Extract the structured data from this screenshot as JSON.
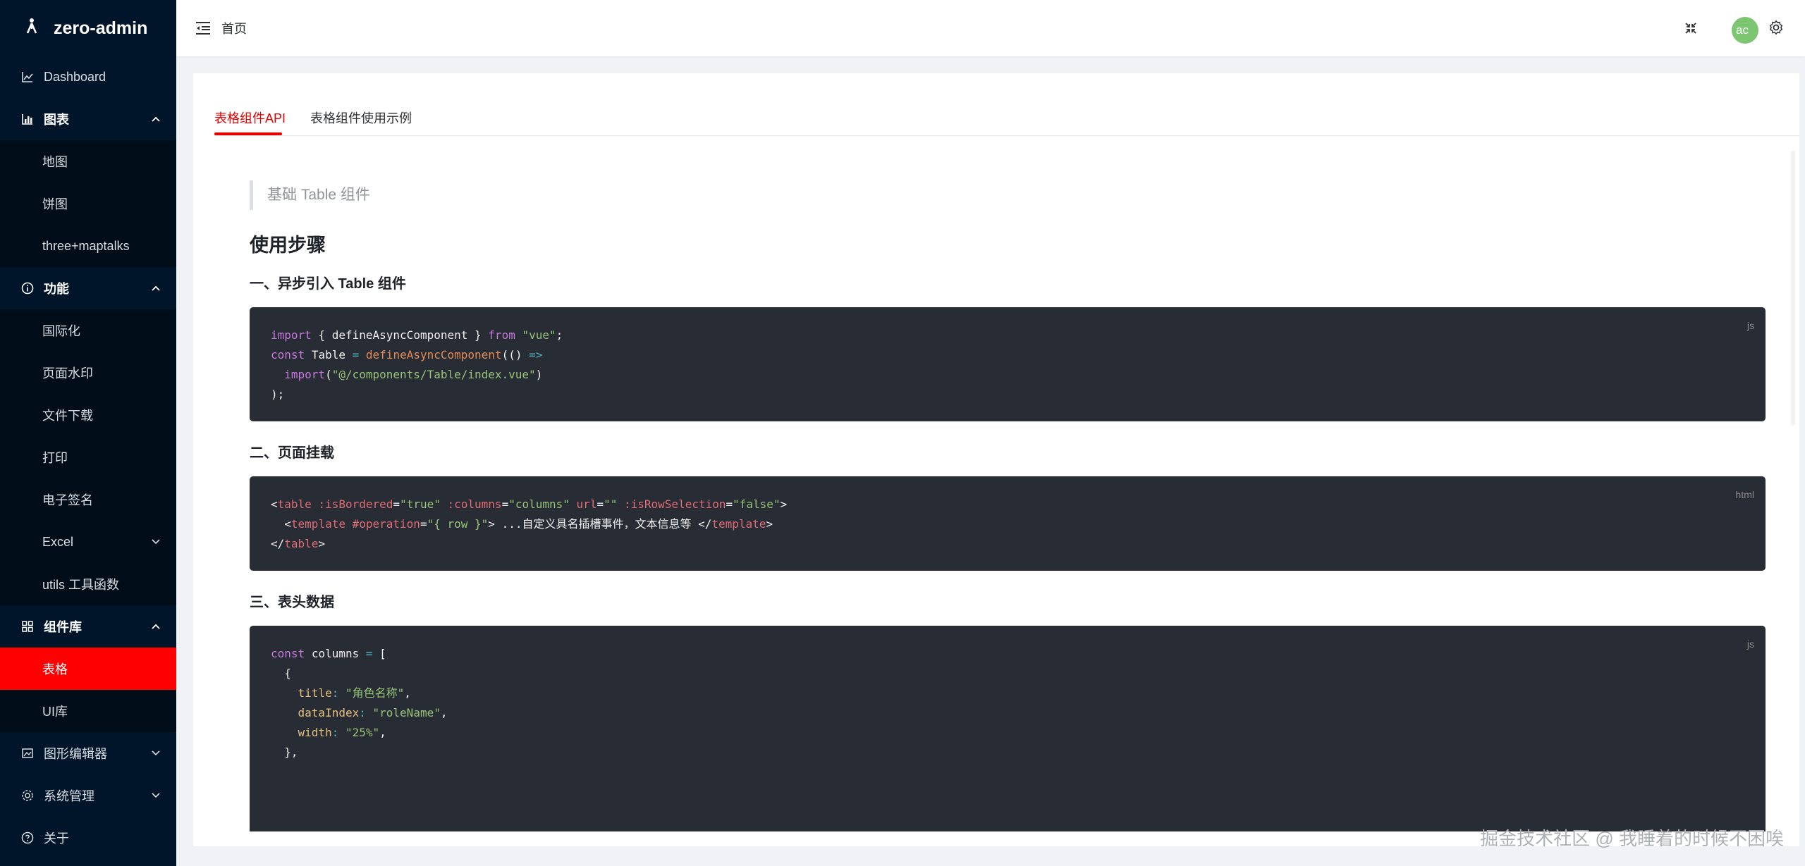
{
  "app": {
    "logo_text": "zero-admin"
  },
  "header": {
    "breadcrumb": "首页",
    "avatar_text": "ac"
  },
  "sidebar": {
    "dashboard": "Dashboard",
    "charts": {
      "title": "图表",
      "items": [
        "地图",
        "饼图",
        "three+maptalks"
      ]
    },
    "features": {
      "title": "功能",
      "items": [
        "国际化",
        "页面水印",
        "文件下载",
        "打印",
        "电子签名",
        "Excel",
        "utils 工具函数"
      ]
    },
    "components": {
      "title": "组件库",
      "items": [
        "表格",
        "UI库"
      ]
    },
    "graphics_editor": "图形编辑器",
    "system": "系统管理",
    "about": "关于"
  },
  "tabs": [
    "表格组件API",
    "表格组件使用示例"
  ],
  "doc": {
    "blockquote": "基础 Table 组件",
    "h1": "使用步骤",
    "step1": "一、异步引入 Table 组件",
    "step2": "二、页面挂载",
    "step3": "三、表头数据",
    "code1_lang": "js",
    "code2_lang": "html",
    "code3_lang": "js"
  },
  "code": {
    "c1": {
      "import_kw": "import",
      "lb": "{",
      "define_async": "defineAsyncComponent",
      "rb": "}",
      "from_kw": "from",
      "vue_str": "\"vue\"",
      "semi": ";",
      "const_kw": "const",
      "table_name": "Table",
      "eq": "=",
      "fn_call": "defineAsyncComponent",
      "paren_open": "((",
      "paren_close": ")",
      "arrow": "=>",
      "import_fn": "import",
      "path_str": "\"@/components/Table/index.vue\"",
      "close_paren": ")",
      "end": ");"
    },
    "c2": {
      "lt": "<",
      "table_tag": "table",
      "attr1": ":isBordered",
      "val1": "\"true\"",
      "attr2": ":columns",
      "val2": "\"columns\"",
      "attr3": "url",
      "val3": "\"\"",
      "attr4": ":isRowSelection",
      "val4": "\"false\"",
      "gt": ">",
      "template_tag": "template",
      "slot_attr": "#operation",
      "slot_val": "\"{ row }\"",
      "slot_text": "...自定义具名插槽事件，文本信息等",
      "close_template": "</",
      "close_table": "</",
      "eq": "="
    },
    "c3": {
      "const_kw": "const",
      "columns_name": "columns",
      "eq": "=",
      "lbracket": "[",
      "lbrace": "{",
      "title_key": "title",
      "title_val": "\"角色名称\"",
      "dataIndex_key": "dataIndex",
      "dataIndex_val": "\"roleName\"",
      "width_key": "width",
      "width_val": "\"25%\"",
      "rbrace": "},",
      "colon": ":",
      "comma": ","
    }
  },
  "watermark": "掘金技术社区 @ 我睡着的时候不困唉"
}
